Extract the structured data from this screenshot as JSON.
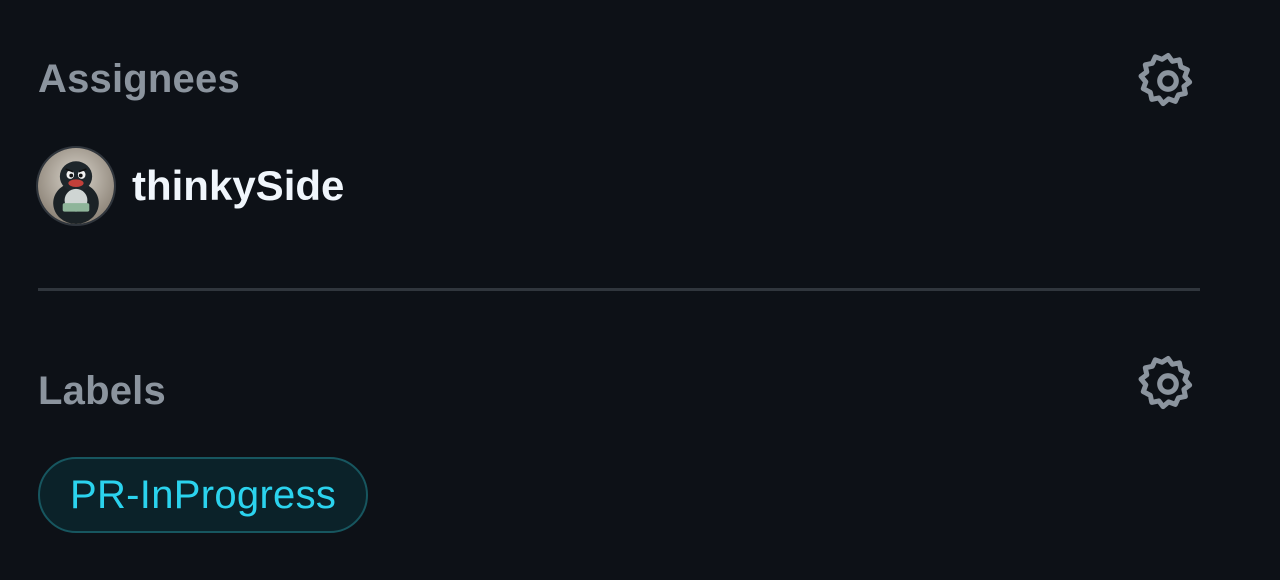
{
  "assignees": {
    "heading": "Assignees",
    "settings_icon": "gear-icon",
    "items": [
      {
        "username": "thinkySide",
        "avatar_icon": "penguin-avatar"
      }
    ]
  },
  "labels": {
    "heading": "Labels",
    "settings_icon": "gear-icon",
    "items": [
      {
        "name": "PR-InProgress",
        "color": "#2bd3ee"
      }
    ]
  },
  "colors": {
    "background": "#0d1117",
    "heading": "#8b949e",
    "text": "#f0f6fc",
    "divider": "#30363d",
    "label_text": "#2bd3ee",
    "label_border": "#17565f",
    "label_bg": "#0b2229"
  }
}
